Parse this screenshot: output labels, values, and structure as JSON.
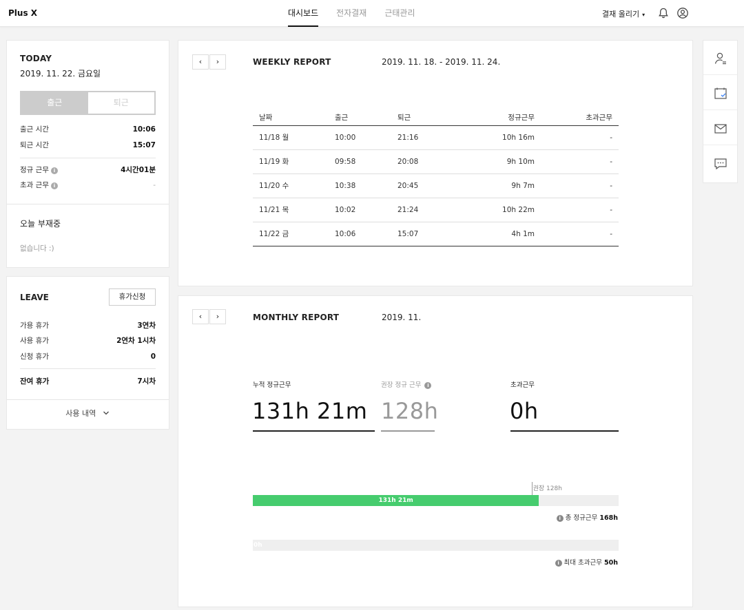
{
  "app": {
    "logo": "Plus X"
  },
  "nav": {
    "tabs": [
      {
        "label": "대시보드"
      },
      {
        "label": "전자결재"
      },
      {
        "label": "근태관리"
      }
    ]
  },
  "header": {
    "approve_label": "결재 올리기",
    "caret": "▾"
  },
  "today": {
    "title": "TODAY",
    "date": "2019. 11. 22. 금요일",
    "btn_in": "출근",
    "btn_out": "퇴근",
    "checkin_label": "출근 시간",
    "checkin_value": "10:06",
    "checkout_label": "퇴근 시간",
    "checkout_value": "15:07",
    "regular_label": "정규 근무",
    "regular_value": "4시간01분",
    "overtime_label": "초과 근무",
    "overtime_value": "-",
    "info": "i",
    "absent_title": "오늘 부재중",
    "absent_text": "없습니다 :)"
  },
  "leave": {
    "title": "LEAVE",
    "request_button": "휴가신청",
    "available_label": "가용 휴가",
    "available_value": "3연차",
    "used_label": "사용 휴가",
    "used_value": "2연차 1시차",
    "requested_label": "신청 휴가",
    "requested_value": "0",
    "remaining_label": "잔여 휴가",
    "remaining_value": "7시차",
    "usage_link": "사용 내역"
  },
  "weekly": {
    "prev": "‹",
    "next": "›",
    "title": "WEEKLY REPORT",
    "range": "2019. 11. 18. - 2019. 11. 24.",
    "headers": [
      "날짜",
      "출근",
      "퇴근",
      "정규근무",
      "초과근무"
    ],
    "rows": [
      [
        "11/18 월",
        "10:00",
        "21:16",
        "10h 16m",
        "-"
      ],
      [
        "11/19 화",
        "09:58",
        "20:08",
        "9h 10m",
        "-"
      ],
      [
        "11/20 수",
        "10:38",
        "20:45",
        "9h 7m",
        "-"
      ],
      [
        "11/21 목",
        "10:02",
        "21:24",
        "10h 22m",
        "-"
      ],
      [
        "11/22 금",
        "10:06",
        "15:07",
        "4h 1m",
        "-"
      ]
    ]
  },
  "monthly": {
    "prev": "‹",
    "next": "›",
    "title": "MONTHLY REPORT",
    "period": "2019. 11.",
    "cumulative_label": "누적 정규근무",
    "cumulative_value": "131h 21m",
    "recommended_label": "권장 정규 근무",
    "recommended_value": "128h",
    "overtime_label": "초과근무",
    "overtime_value": "0h",
    "marker_label": "권장 128h",
    "bar1_label": "131h 21m",
    "bar1_fraction": 0.782,
    "marker_fraction": 0.762,
    "bar1_note_prefix": "총 정규근무",
    "bar1_note_value": "168h",
    "bar2_label": "0h",
    "bar2_fraction": 0,
    "bar2_note_prefix": "최대 초과근무",
    "bar2_note_value": "50h",
    "info": "i"
  },
  "colors": {
    "accent_green": "#46cc6e",
    "toggle_gray": "#cccccc"
  },
  "rail": {
    "icons": [
      "user-icon",
      "calendar-check-icon",
      "mail-icon",
      "chat-icon"
    ]
  }
}
